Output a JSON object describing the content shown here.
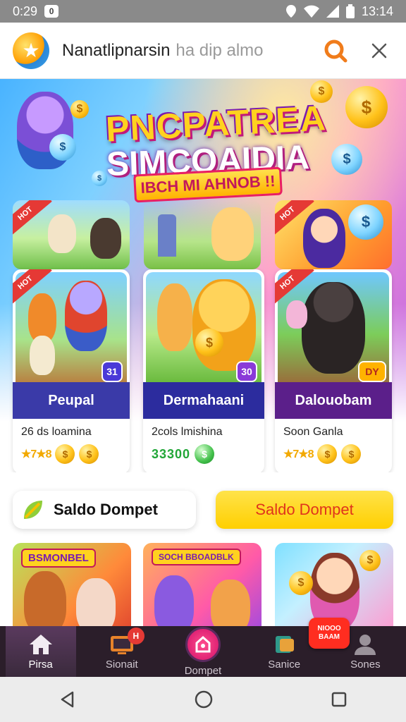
{
  "status_bar": {
    "time": "0:29",
    "right_time": "13:14",
    "badge": "0"
  },
  "app_header": {
    "title": "Nanatlipnarsin",
    "subtitle": "ha dip almo"
  },
  "hero": {
    "title_line1": "PNCPATREA",
    "title_line2": "SIMCOAIDIA",
    "banner": "IBCH MI AHNOB !!"
  },
  "games": [
    {
      "name": "Peupal",
      "subtitle": "26 ds loamina",
      "rating": "★7★8",
      "badge": "31",
      "name_color": "#3a3aa8"
    },
    {
      "name": "Dermahaani",
      "subtitle": "2cols lmishina",
      "points": "33300",
      "badge": "30",
      "name_color": "#2c2c9e"
    },
    {
      "name": "Dalouobam",
      "subtitle": "Soon Ganla",
      "rating": "★7★8",
      "badge": "DY",
      "name_color": "#5b1f8a"
    }
  ],
  "saldo": {
    "left_label": "Saldo Dompet",
    "right_label": "Saldo Dompet"
  },
  "promos": [
    {
      "tag": "BSMONBEL"
    },
    {
      "tag": "SOCH BBOADBLK"
    },
    {
      "tag": ""
    }
  ],
  "bottom_nav": {
    "items": [
      {
        "label": "Pirsa",
        "icon": "home-icon"
      },
      {
        "label": "Sionait",
        "icon": "tv-icon",
        "badge": "H"
      },
      {
        "label": "Dompet",
        "icon": "wallet-icon"
      },
      {
        "label": "Sanice",
        "icon": "card-icon"
      },
      {
        "label": "Sones",
        "icon": "user-icon"
      }
    ],
    "promo_pill": "NIOOO BAAM"
  }
}
